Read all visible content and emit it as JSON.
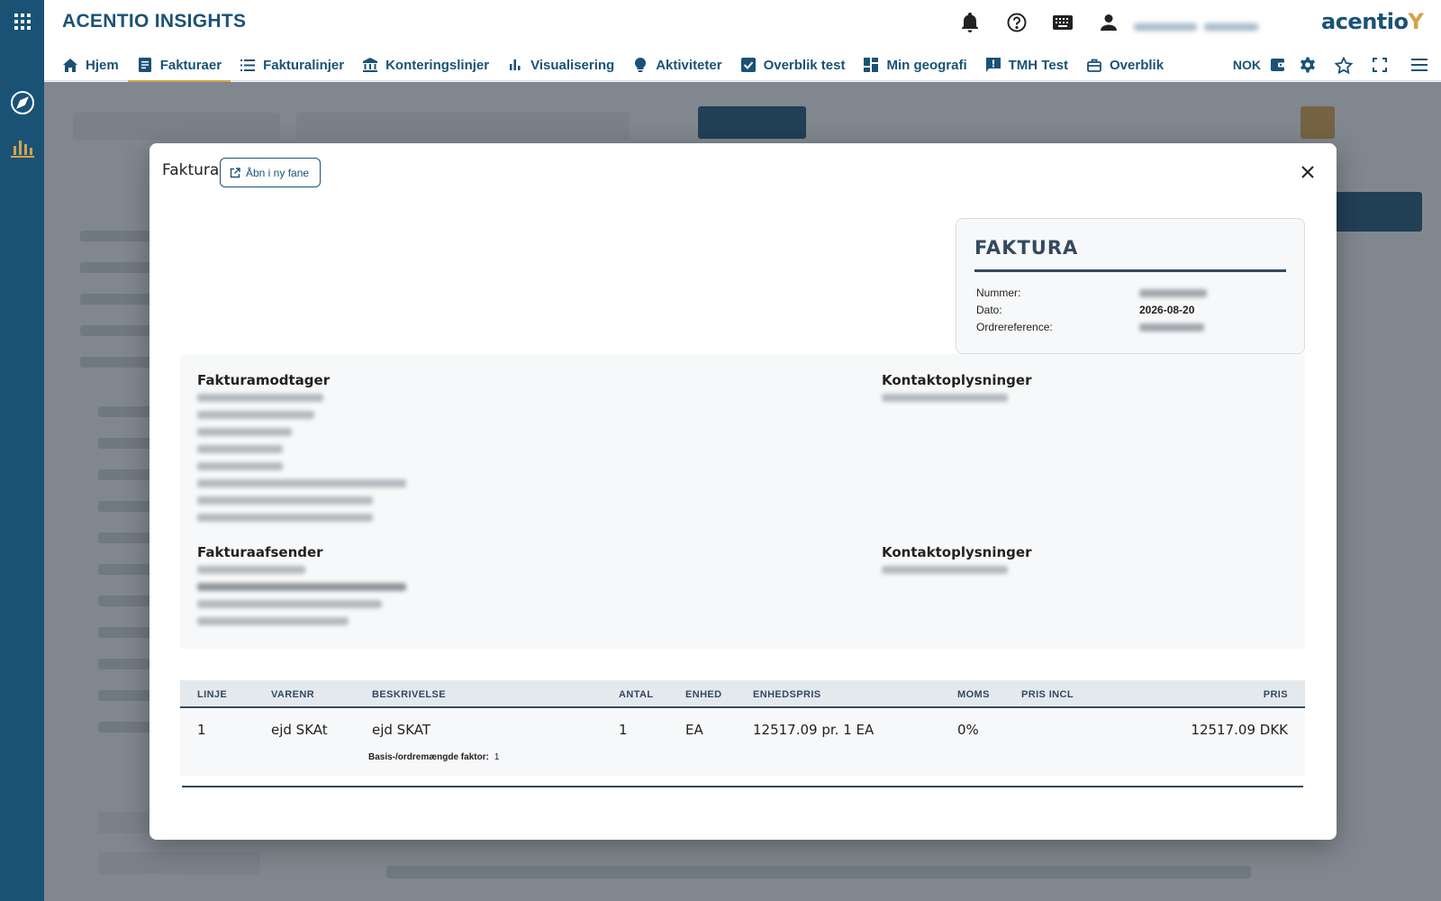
{
  "app": {
    "title": "ACENTIO INSIGHTS",
    "brand": "acentio",
    "brand_mark": "Y"
  },
  "rail": {
    "items": [
      "apps-grid-icon",
      "explore-icon",
      "analytics-icon"
    ]
  },
  "header": {
    "icons": [
      "notifications-icon",
      "help-icon",
      "keyboard-icon",
      "account-icon"
    ]
  },
  "nav": {
    "items": [
      {
        "label": "Hjem",
        "icon": "home-icon",
        "active": false
      },
      {
        "label": "Fakturaer",
        "icon": "invoice-icon",
        "active": true
      },
      {
        "label": "Fakturalinjer",
        "icon": "list-icon",
        "active": false
      },
      {
        "label": "Konteringslinjer",
        "icon": "bank-icon",
        "active": false
      },
      {
        "label": "Visualisering",
        "icon": "bar-chart-icon",
        "active": false
      },
      {
        "label": "Aktiviteter",
        "icon": "lightbulb-icon",
        "active": false
      },
      {
        "label": "Overblik test",
        "icon": "checkbox-icon",
        "active": false
      },
      {
        "label": "Min geografi",
        "icon": "dashboard-icon",
        "active": false
      },
      {
        "label": "TMH Test",
        "icon": "feedback-icon",
        "active": false
      },
      {
        "label": "Overblik",
        "icon": "briefcase-icon",
        "active": false
      }
    ],
    "currency": "NOK",
    "right_icons": [
      "wallet-icon",
      "settings-icon",
      "star-icon",
      "fullscreen-icon",
      "menu-icon"
    ]
  },
  "modal": {
    "title": "Faktura",
    "open_new_tab": "Åbn i ny fane",
    "invoice_card": {
      "heading": "FAKTURA",
      "number_label": "Nummer:",
      "date_label": "Dato:",
      "date_value": "2026-08-20",
      "order_ref_label": "Ordrereference:"
    },
    "recipient_heading": "Fakturamodtager",
    "recipient_contact_heading": "Kontaktoplysninger",
    "sender_heading": "Fakturaafsender",
    "sender_contact_heading": "Kontaktoplysninger",
    "table": {
      "headers": [
        "LINJE",
        "VARENR",
        "BESKRIVELSE",
        "ANTAL",
        "ENHED",
        "ENHEDSPRIS",
        "MOMS",
        "PRIS INCL",
        "PRIS"
      ],
      "rows": [
        {
          "linje": "1",
          "varenr": "ejd SKAt",
          "beskrivelse": "ejd SKAT",
          "antal": "1",
          "enhed": "EA",
          "enhedspris": "12517.09 pr. 1 EA",
          "moms": "0%",
          "pris_incl": "",
          "pris": "12517.09 DKK",
          "factor_label": "Basis-/ordremængde faktor:",
          "factor_value": "1"
        }
      ]
    }
  },
  "colors": {
    "primary": "#1a5276",
    "accent": "#d4a24c",
    "dark": "#34495e"
  }
}
